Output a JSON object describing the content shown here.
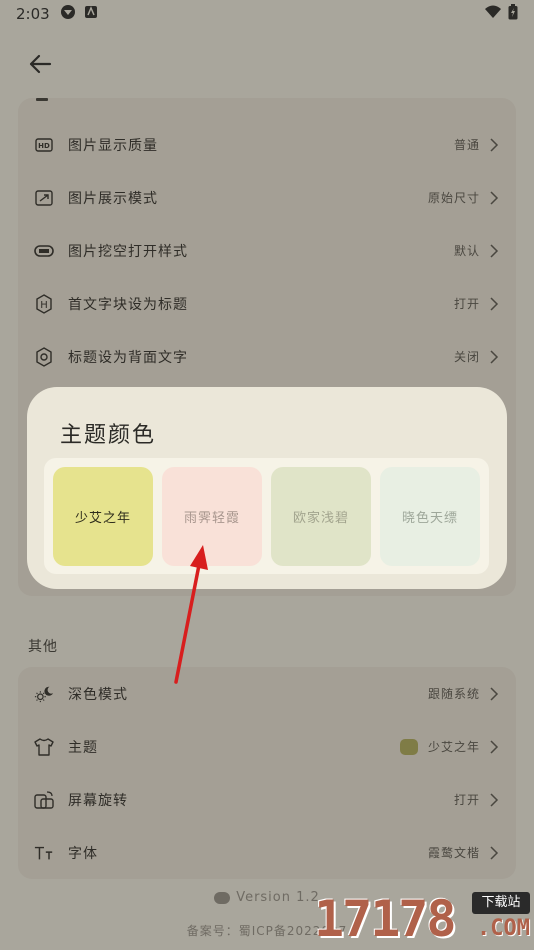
{
  "status_bar": {
    "time": "2:03"
  },
  "nav": {
    "back_icon": "arrow-left-icon"
  },
  "settings_rows": [
    {
      "icon": "hd-icon",
      "label": "图片显示质量",
      "value": "普通"
    },
    {
      "icon": "resize-icon",
      "label": "图片展示模式",
      "value": "原始尺寸"
    },
    {
      "icon": "cutout-icon",
      "label": "图片挖空打开样式",
      "value": "默认"
    },
    {
      "icon": "heading-icon",
      "label": "首文字块设为标题",
      "value": "打开"
    },
    {
      "icon": "settings-icon",
      "label": "标题设为背面文字",
      "value": "关闭"
    }
  ],
  "other_section": {
    "title": "其他",
    "rows": [
      {
        "icon": "day-night-icon",
        "label": "深色模式",
        "value": "跟随系统"
      },
      {
        "icon": "shirt-icon",
        "label": "主题",
        "value": "少艾之年",
        "swatch_color": "#7f7c46"
      },
      {
        "icon": "rotate-icon",
        "label": "屏幕旋转",
        "value": "打开"
      },
      {
        "icon": "font-icon",
        "label": "字体",
        "value": "霞鹜文楷"
      }
    ]
  },
  "footer": {
    "version": "Version 1.2",
    "icp": "备案号：蜀ICP备2022007"
  },
  "theme_dialog": {
    "title": "主题颜色",
    "options": [
      {
        "label": "少艾之年",
        "bg": "#e6e38e",
        "fg": "#2f2d1c"
      },
      {
        "label": "雨霁轻霞",
        "bg": "#f9e1d8",
        "fg": "#a8968e"
      },
      {
        "label": "欧家浅碧",
        "bg": "#e0e4c8",
        "fg": "#a2a48e"
      },
      {
        "label": "晓色天缥",
        "bg": "#e8efe3",
        "fg": "#9ea79a"
      }
    ]
  },
  "watermark": {
    "digits": "17178",
    "badge": "下载站",
    "suffix": ".COM"
  }
}
